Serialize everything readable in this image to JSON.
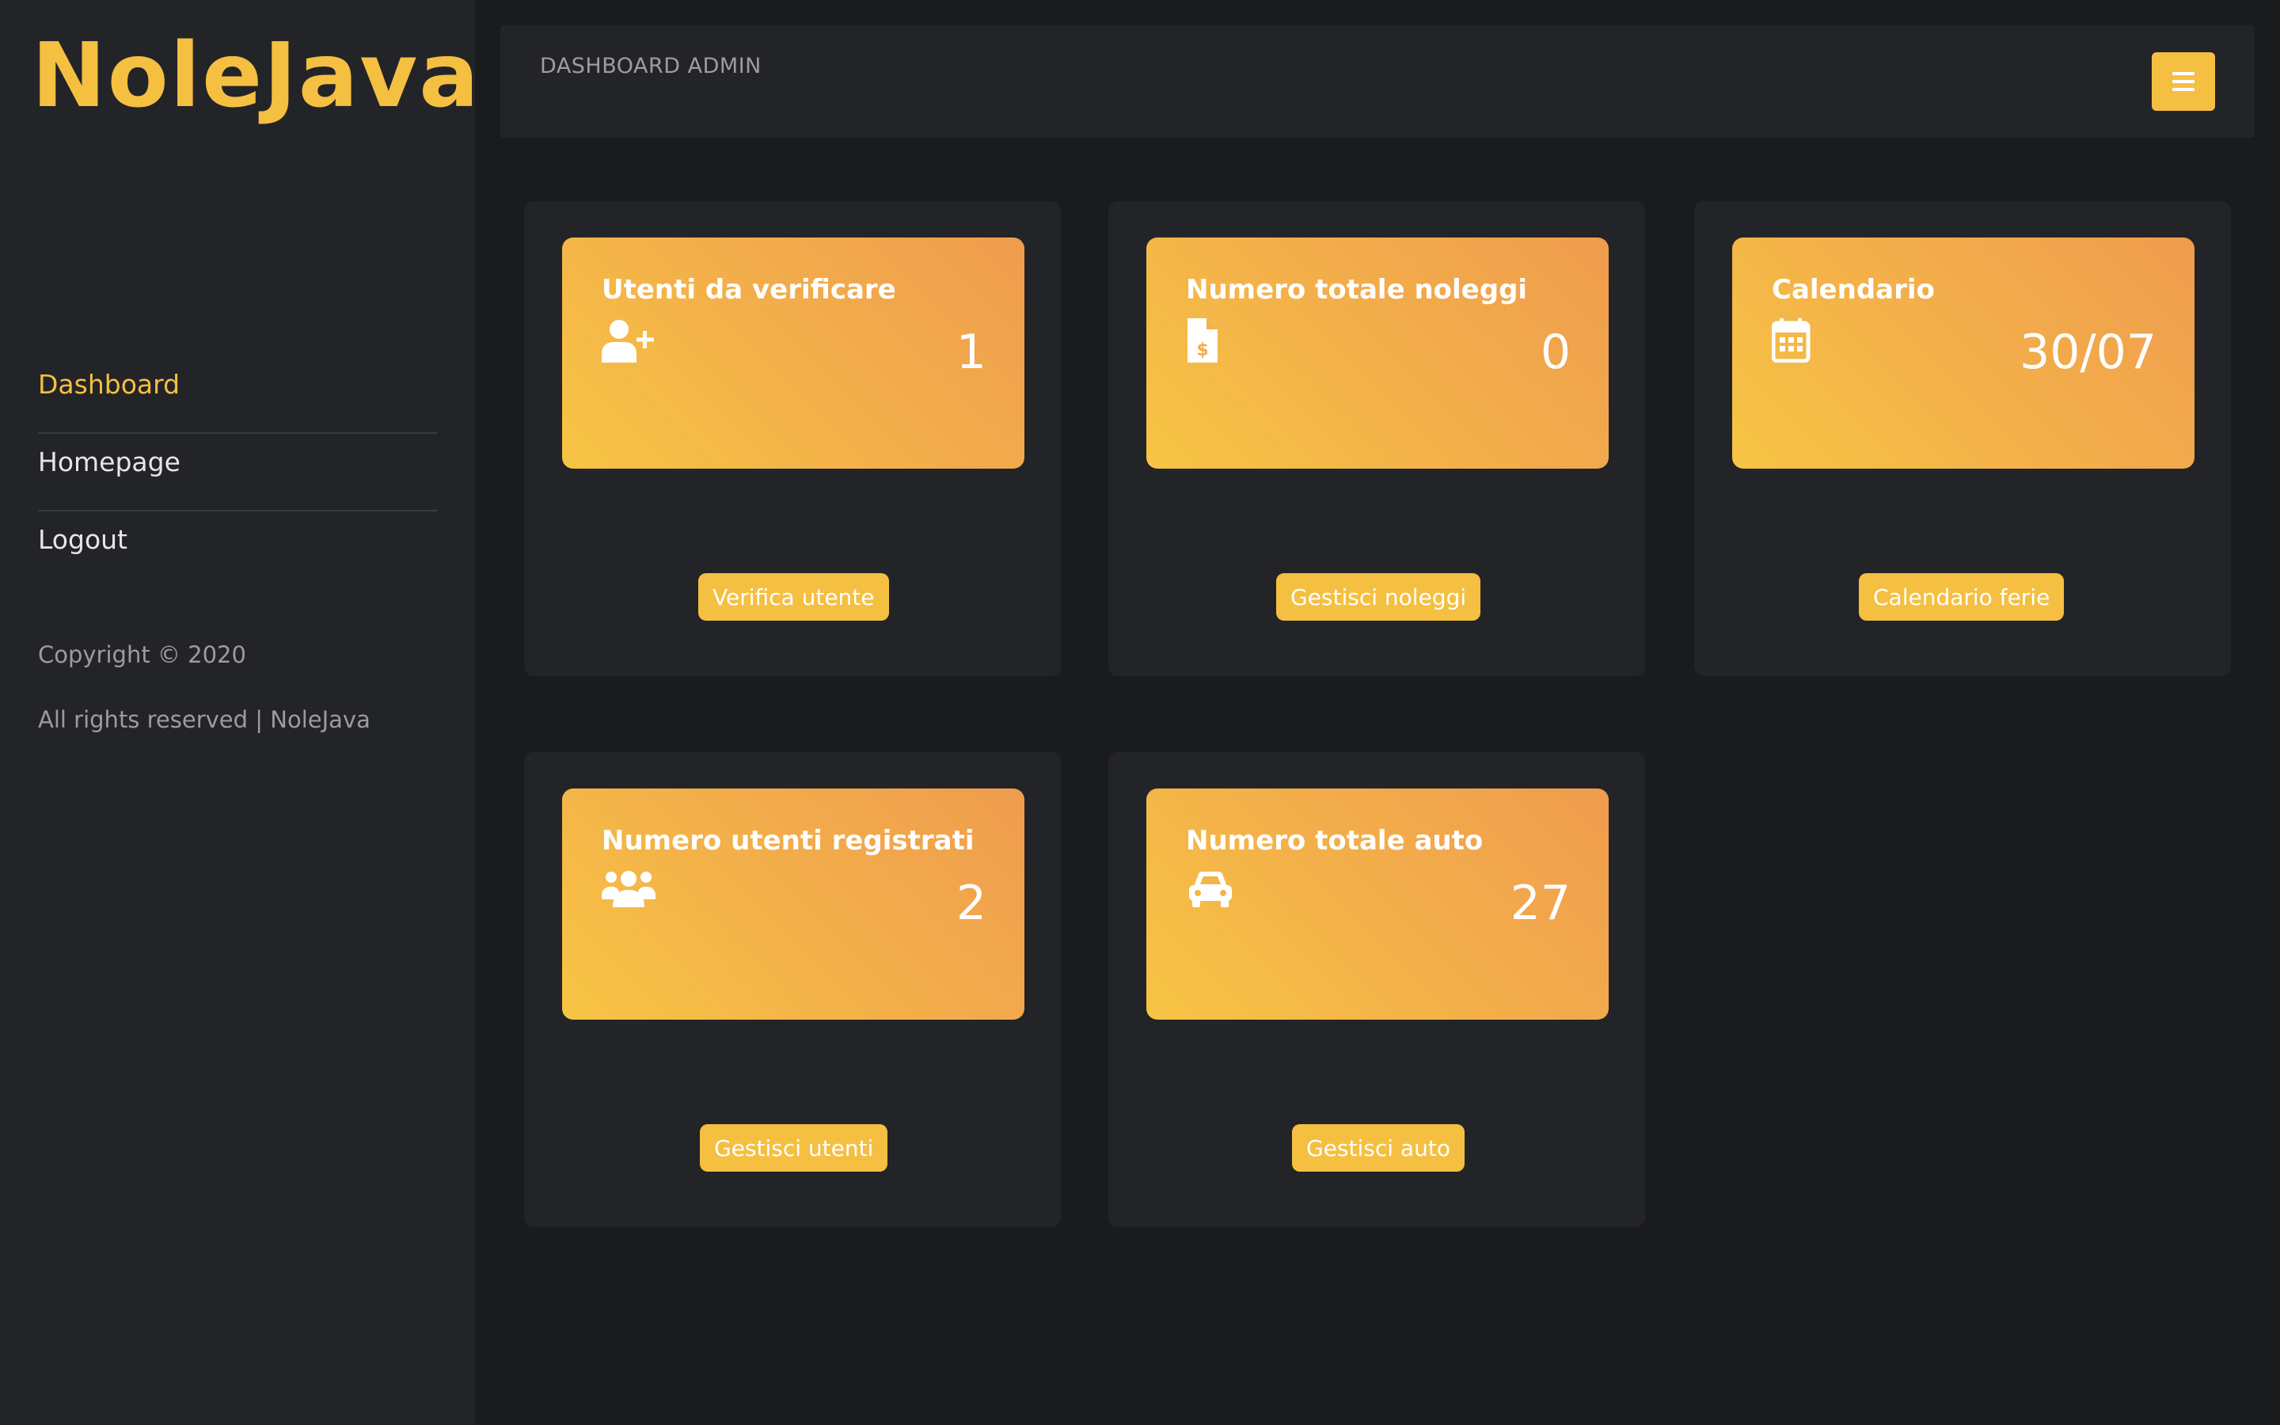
{
  "sidebar": {
    "brand": "NoleJava",
    "nav": [
      {
        "label": "Dashboard",
        "active": true
      },
      {
        "label": "Homepage",
        "active": false
      },
      {
        "label": "Logout",
        "active": false
      }
    ],
    "copyright": "Copyright © 2020",
    "rights": "All rights reserved | NoleJava"
  },
  "header": {
    "title": "DASHBOARD ADMIN",
    "menu_icon": "hamburger-menu-icon"
  },
  "cards": [
    {
      "title": "Utenti da verificare",
      "icon": "user-plus-icon",
      "value": "1",
      "button": "Verifica utente"
    },
    {
      "title": "Numero totale noleggi",
      "icon": "invoice-dollar-icon",
      "value": "0",
      "button": "Gestisci noleggi"
    },
    {
      "title": "Calendario",
      "icon": "calendar-icon",
      "value": "30/07",
      "button": "Calendario ferie"
    },
    {
      "title": "Numero utenti registrati",
      "icon": "users-icon",
      "value": "2",
      "button": "Gestisci utenti"
    },
    {
      "title": "Numero totale auto",
      "icon": "car-icon",
      "value": "27",
      "button": "Gestisci auto"
    }
  ],
  "colors": {
    "accent": "#f5bf41",
    "background": "#1a1b1d",
    "panel": "#232427",
    "gradient_start": "#f7c444",
    "gradient_end": "#ef9c4d"
  }
}
